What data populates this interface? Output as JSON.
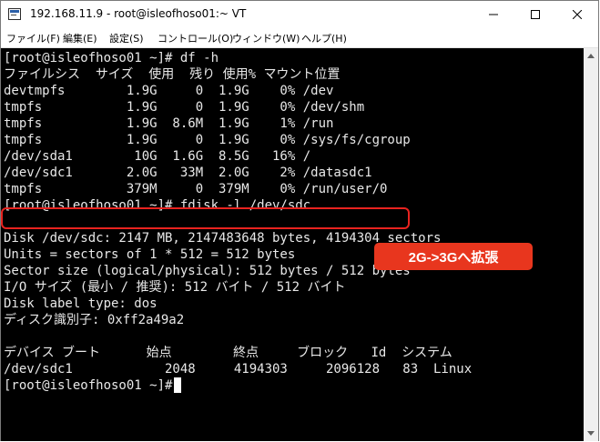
{
  "window": {
    "title": "192.168.11.9 - root@isleofhoso01:~ VT",
    "app_icon": "terminal-app-icon",
    "controls": [
      "minimize-icon",
      "maximize-icon",
      "close-icon"
    ]
  },
  "menu": {
    "items": [
      "ファイル(F)",
      "編集(E)",
      "設定(S)",
      "コントロール(O)",
      "ウィンドウ(W)",
      "ヘルプ(H)"
    ]
  },
  "terminal": {
    "lines": [
      "[root@isleofhoso01 ~]# df -h",
      "ファイルシス  サイズ  使用  残り 使用% マウント位置",
      "devtmpfs        1.9G     0  1.9G    0% /dev",
      "tmpfs           1.9G     0  1.9G    0% /dev/shm",
      "tmpfs           1.9G  8.6M  1.9G    1% /run",
      "tmpfs           1.9G     0  1.9G    0% /sys/fs/cgroup",
      "/dev/sda1        10G  1.6G  8.5G   16% /",
      "/dev/sdc1       2.0G   33M  2.0G    2% /datasdc1",
      "tmpfs           379M     0  379M    0% /run/user/0",
      "[root@isleofhoso01 ~]# fdisk -l /dev/sdc",
      "",
      "Disk /dev/sdc: 2147 MB, 2147483648 bytes, 4194304 sectors",
      "Units = sectors of 1 * 512 = 512 bytes",
      "Sector size (logical/physical): 512 bytes / 512 bytes",
      "I/O サイズ (最小 / 推奨): 512 バイト / 512 バイト",
      "Disk label type: dos",
      "ディスク識別子: 0xff2a49a2",
      "",
      "デバイス ブート      始点        終点     ブロック   Id  システム",
      "/dev/sdc1            2048     4194303     2096128   83  Linux",
      "[root@isleofhoso01 ~]#"
    ],
    "cursor": "cursor-block"
  },
  "annotation": {
    "callout_text": "2G->3Gへ拡張",
    "highlight_color": "#e8231f",
    "callout_color": "#e8361e"
  },
  "scrollbar": {
    "icons": [
      "scroll-up-arrow-icon",
      "scroll-down-arrow-icon"
    ]
  }
}
